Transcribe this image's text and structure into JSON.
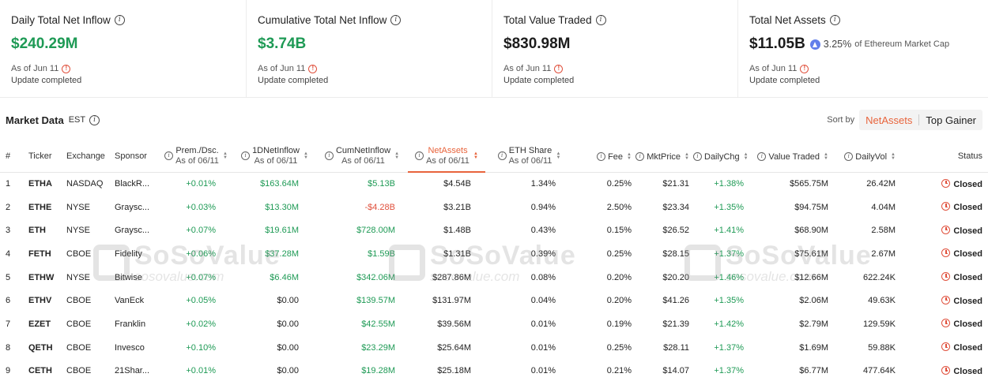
{
  "cards": [
    {
      "title": "Daily Total Net Inflow",
      "value": "$240.29M",
      "value_color": "green",
      "asof": "As of Jun 11",
      "status": "Update completed"
    },
    {
      "title": "Cumulative Total Net Inflow",
      "value": "$3.74B",
      "value_color": "green",
      "asof": "As of Jun 11",
      "status": "Update completed"
    },
    {
      "title": "Total Value Traded",
      "value": "$830.98M",
      "value_color": "dark",
      "asof": "As of Jun 11",
      "status": "Update completed"
    },
    {
      "title": "Total Net Assets",
      "value": "$11.05B",
      "value_color": "dark",
      "share_pct": "3.25%",
      "share_label": "of Ethereum Market Cap",
      "asof": "As of Jun 11",
      "status": "Update completed"
    }
  ],
  "market": {
    "title": "Market Data",
    "timezone": "EST",
    "sort_label": "Sort by",
    "sort_options": [
      "NetAssets",
      "Top Gainer"
    ],
    "sort_active": "NetAssets"
  },
  "columns": {
    "num": "#",
    "ticker": "Ticker",
    "exchange": "Exchange",
    "sponsor": "Sponsor",
    "prem": "Prem./Dsc.",
    "prem_sub": "As of 06/11",
    "d1": "1DNetInflow",
    "d1_sub": "As of 06/11",
    "cum": "CumNetInflow",
    "cum_sub": "As of 06/11",
    "na": "NetAssets",
    "na_sub": "As of 06/11",
    "share": "ETH Share",
    "share_sub": "As of 06/11",
    "fee": "Fee",
    "price": "MktPrice",
    "chg": "DailyChg",
    "vt": "Value Traded",
    "vol": "DailyVol",
    "status": "Status"
  },
  "rows": [
    {
      "num": "1",
      "ticker": "ETHA",
      "exchange": "NASDAQ",
      "sponsor": "BlackR...",
      "prem": "+0.01%",
      "d1": "$163.64M",
      "cum": "$5.13B",
      "na": "$4.54B",
      "share": "1.34%",
      "fee": "0.25%",
      "price": "$21.31",
      "chg": "+1.38%",
      "vt": "$565.75M",
      "vol": "26.42M",
      "status": "Closed"
    },
    {
      "num": "2",
      "ticker": "ETHE",
      "exchange": "NYSE",
      "sponsor": "Graysc...",
      "prem": "+0.03%",
      "d1": "$13.30M",
      "cum": "-$4.28B",
      "na": "$3.21B",
      "share": "0.94%",
      "fee": "2.50%",
      "price": "$23.34",
      "chg": "+1.35%",
      "vt": "$94.75M",
      "vol": "4.04M",
      "status": "Closed"
    },
    {
      "num": "3",
      "ticker": "ETH",
      "exchange": "NYSE",
      "sponsor": "Graysc...",
      "prem": "+0.07%",
      "d1": "$19.61M",
      "cum": "$728.00M",
      "na": "$1.48B",
      "share": "0.43%",
      "fee": "0.15%",
      "price": "$26.52",
      "chg": "+1.41%",
      "vt": "$68.90M",
      "vol": "2.58M",
      "status": "Closed"
    },
    {
      "num": "4",
      "ticker": "FETH",
      "exchange": "CBOE",
      "sponsor": "Fidelity",
      "prem": "+0.06%",
      "d1": "$37.28M",
      "cum": "$1.59B",
      "na": "$1.31B",
      "share": "0.39%",
      "fee": "0.25%",
      "price": "$28.15",
      "chg": "+1.37%",
      "vt": "$75.61M",
      "vol": "2.67M",
      "status": "Closed"
    },
    {
      "num": "5",
      "ticker": "ETHW",
      "exchange": "NYSE",
      "sponsor": "Bitwise",
      "prem": "+0.07%",
      "d1": "$6.46M",
      "cum": "$342.06M",
      "na": "$287.86M",
      "share": "0.08%",
      "fee": "0.20%",
      "price": "$20.20",
      "chg": "+1.46%",
      "vt": "$12.66M",
      "vol": "622.24K",
      "status": "Closed"
    },
    {
      "num": "6",
      "ticker": "ETHV",
      "exchange": "CBOE",
      "sponsor": "VanEck",
      "prem": "+0.05%",
      "d1": "$0.00",
      "cum": "$139.57M",
      "na": "$131.97M",
      "share": "0.04%",
      "fee": "0.20%",
      "price": "$41.26",
      "chg": "+1.35%",
      "vt": "$2.06M",
      "vol": "49.63K",
      "status": "Closed"
    },
    {
      "num": "7",
      "ticker": "EZET",
      "exchange": "CBOE",
      "sponsor": "Franklin",
      "prem": "+0.02%",
      "d1": "$0.00",
      "cum": "$42.55M",
      "na": "$39.56M",
      "share": "0.01%",
      "fee": "0.19%",
      "price": "$21.39",
      "chg": "+1.42%",
      "vt": "$2.79M",
      "vol": "129.59K",
      "status": "Closed"
    },
    {
      "num": "8",
      "ticker": "QETH",
      "exchange": "CBOE",
      "sponsor": "Invesco",
      "prem": "+0.10%",
      "d1": "$0.00",
      "cum": "$23.29M",
      "na": "$25.64M",
      "share": "0.01%",
      "fee": "0.25%",
      "price": "$28.11",
      "chg": "+1.37%",
      "vt": "$1.69M",
      "vol": "59.88K",
      "status": "Closed"
    },
    {
      "num": "9",
      "ticker": "CETH",
      "exchange": "CBOE",
      "sponsor": "21Shar...",
      "prem": "+0.01%",
      "d1": "$0.00",
      "cum": "$19.28M",
      "na": "$25.18M",
      "share": "0.01%",
      "fee": "0.21%",
      "price": "$14.07",
      "chg": "+1.37%",
      "vt": "$6.77M",
      "vol": "477.64K",
      "status": "Closed"
    }
  ],
  "watermark": {
    "brand": "SoSoValue",
    "url": "sosovalue.com"
  },
  "colors": {
    "positive": "#1e9a55",
    "negative": "#e0503c",
    "accent": "#e8643c",
    "eth": "#627eea"
  }
}
